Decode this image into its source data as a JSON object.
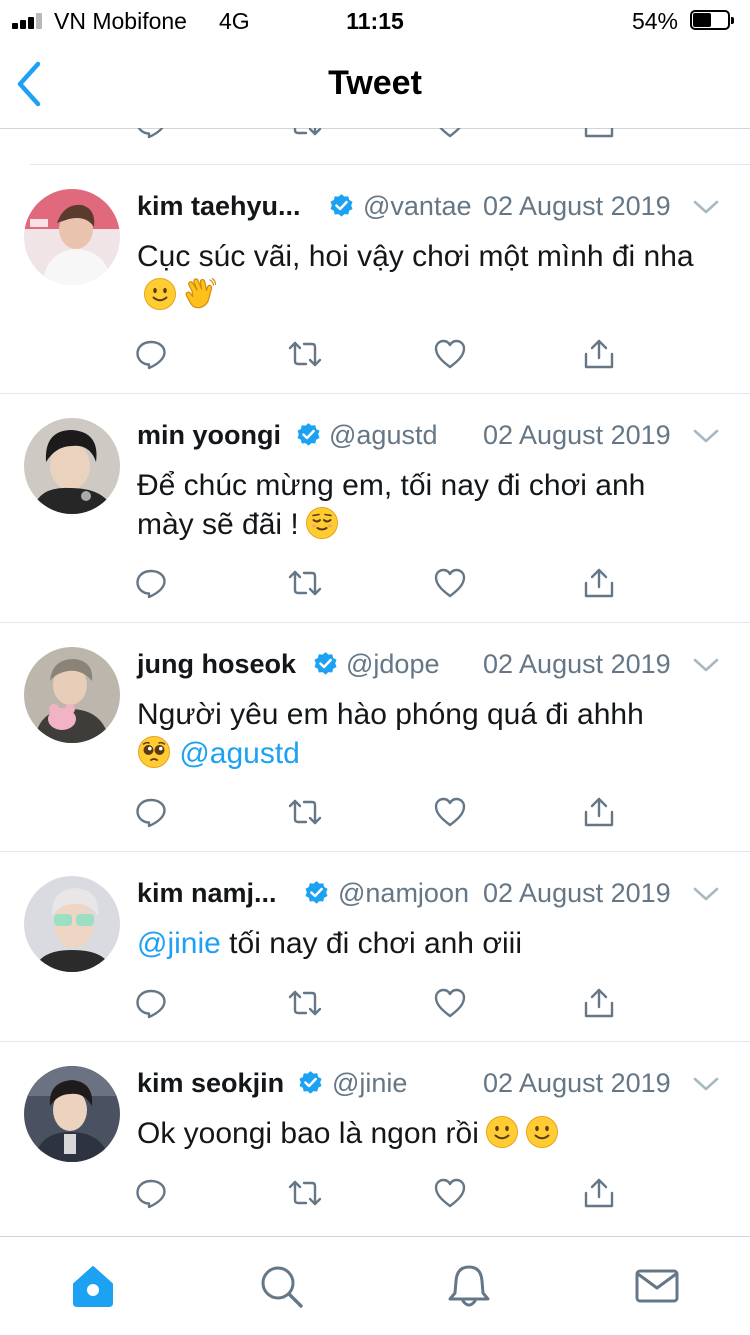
{
  "status_bar": {
    "carrier": "VN Mobifone",
    "network": "4G",
    "time": "11:15",
    "battery": "54%",
    "battery_level": 0.54
  },
  "nav": {
    "title": "Tweet"
  },
  "accent_color": "#1da1f2",
  "tweets": [
    {
      "name": "kim taehyu...",
      "handle": "@vantae",
      "date": "02 August 2019",
      "text": "Cục súc vãi, hoi vậy chơi một mình đi nha",
      "emojis": [
        "slightly-smiling-face",
        "waving-hand"
      ]
    },
    {
      "name": "min yoongi",
      "handle": "@agustd",
      "date": "02 August 2019",
      "text": "Để chúc mừng em, tối nay đi chơi anh mày sẽ đãi !",
      "emojis": [
        "relieved-face"
      ]
    },
    {
      "name": "jung hoseok",
      "handle": "@jdope",
      "date": "02 August 2019",
      "text": "Người yêu em hào phóng quá đi ahhh",
      "emojis": [
        "pleading-face"
      ],
      "mention": "@agustd"
    },
    {
      "name": "kim namj...",
      "handle": "@namjoon",
      "date": "02 August 2019",
      "mention": "@jinie",
      "text": "tối nay đi chơi anh ơiii"
    },
    {
      "name": "kim seokjin",
      "handle": "@jinie",
      "date": "02 August 2019",
      "text": "Ok yoongi bao là ngon rồi",
      "emojis": [
        "slightly-smiling-face",
        "slightly-smiling-face"
      ]
    }
  ],
  "tab_bar": {
    "tabs": [
      "home-icon",
      "search-icon",
      "notifications-icon",
      "messages-icon"
    ],
    "active": "home-icon"
  }
}
